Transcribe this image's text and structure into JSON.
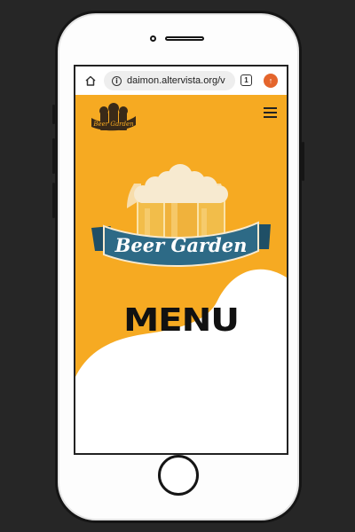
{
  "browser": {
    "url": "daimon.altervista.org/v",
    "tab_count": "1"
  },
  "site": {
    "logo_small_text": "Beer Garden",
    "hero_logo_text": "Beer Garden",
    "heading": "MENU"
  },
  "colors": {
    "background": "#262626",
    "hero_orange": "#f6aa22",
    "ribbon_blue": "#2d6a86",
    "beer_amber": "#f0b23c",
    "foam": "#f7ead0"
  },
  "icons": [
    "home-icon",
    "info-icon",
    "tabs-icon",
    "extension-icon",
    "hamburger-menu-icon"
  ]
}
